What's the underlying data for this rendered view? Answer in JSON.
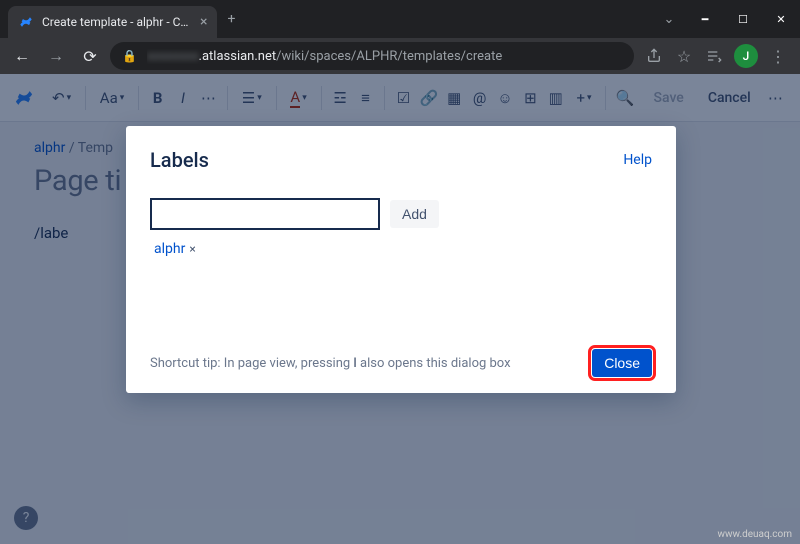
{
  "browser": {
    "tab_title": "Create template - alphr - Conflue",
    "new_tab_icon": "+",
    "url_blurred_prefix": "",
    "url_domain": ".atlassian.net",
    "url_path": "/wiki/spaces/ALPHR/templates/create",
    "avatar_letter": "J"
  },
  "toolbar": {
    "text_size": "Aa",
    "save": "Save",
    "cancel": "Cancel"
  },
  "page": {
    "breadcrumb_space": "alphr",
    "breadcrumb_sep": " / ",
    "breadcrumb_item": "Temp",
    "title_placeholder": "Page ti",
    "body_text": "/labe"
  },
  "dialog": {
    "title": "Labels",
    "help": "Help",
    "input_value": "",
    "add": "Add",
    "chip_label": "alphr",
    "chip_remove": "×",
    "tip_prefix": "Shortcut tip: In page view, pressing ",
    "tip_key": "l",
    "tip_suffix": " also opens this dialog box",
    "close": "Close"
  },
  "watermark": "www.deuaq.com"
}
